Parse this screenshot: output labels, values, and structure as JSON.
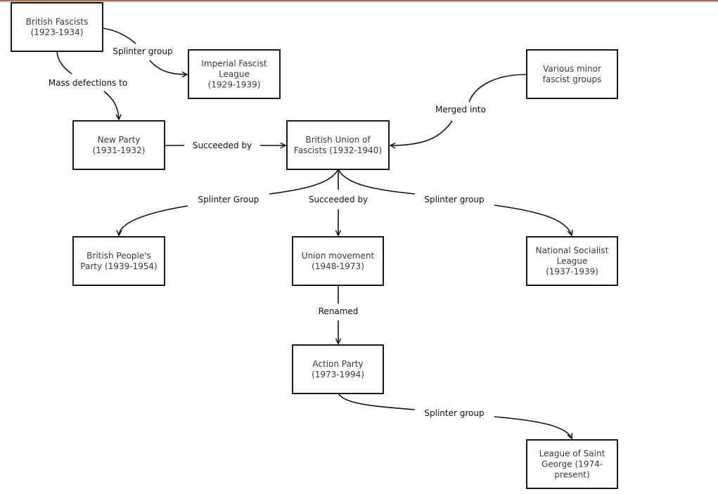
{
  "diagram": {
    "type": "flowchart",
    "nodes": [
      {
        "id": "british_fascists",
        "lines": [
          "British Fascists",
          "(1923-1934)"
        ]
      },
      {
        "id": "imperial_fascist_league",
        "lines": [
          "Imperial Fascist",
          "League",
          "(1929-1939)"
        ]
      },
      {
        "id": "various_minor",
        "lines": [
          "Various minor",
          "fascist groups"
        ]
      },
      {
        "id": "new_party",
        "lines": [
          "New Party",
          "(1931-1932)"
        ]
      },
      {
        "id": "buf",
        "lines": [
          "British Union of",
          "Fascists (1932-1940)"
        ]
      },
      {
        "id": "british_peoples_party",
        "lines": [
          "British People's",
          "Party (1939-1954)"
        ]
      },
      {
        "id": "union_movement",
        "lines": [
          "Union movement",
          "(1948-1973)"
        ]
      },
      {
        "id": "national_socialist_league",
        "lines": [
          "National Socialist",
          "League",
          "(1937-1939)"
        ]
      },
      {
        "id": "action_party",
        "lines": [
          "Action Party",
          "(1973-1994)"
        ]
      },
      {
        "id": "league_saint_george",
        "lines": [
          "League of Saint",
          "George (1974-",
          "present)"
        ]
      }
    ],
    "edges": [
      {
        "id": "e1",
        "from": "british_fascists",
        "to": "imperial_fascist_league",
        "label": "Splinter group"
      },
      {
        "id": "e2",
        "from": "british_fascists",
        "to": "new_party",
        "label": "Mass defections to"
      },
      {
        "id": "e3",
        "from": "new_party",
        "to": "buf",
        "label": "Succeeded by"
      },
      {
        "id": "e4",
        "from": "various_minor",
        "to": "buf",
        "label": "Merged into"
      },
      {
        "id": "e5",
        "from": "buf",
        "to": "british_peoples_party",
        "label": "Splinter Group"
      },
      {
        "id": "e6",
        "from": "buf",
        "to": "union_movement",
        "label": "Succeeded by"
      },
      {
        "id": "e7",
        "from": "buf",
        "to": "national_socialist_league",
        "label": "Splinter group"
      },
      {
        "id": "e8",
        "from": "union_movement",
        "to": "action_party",
        "label": "Renamed"
      },
      {
        "id": "e9",
        "from": "action_party",
        "to": "league_saint_george",
        "label": "Splinter group"
      }
    ]
  }
}
